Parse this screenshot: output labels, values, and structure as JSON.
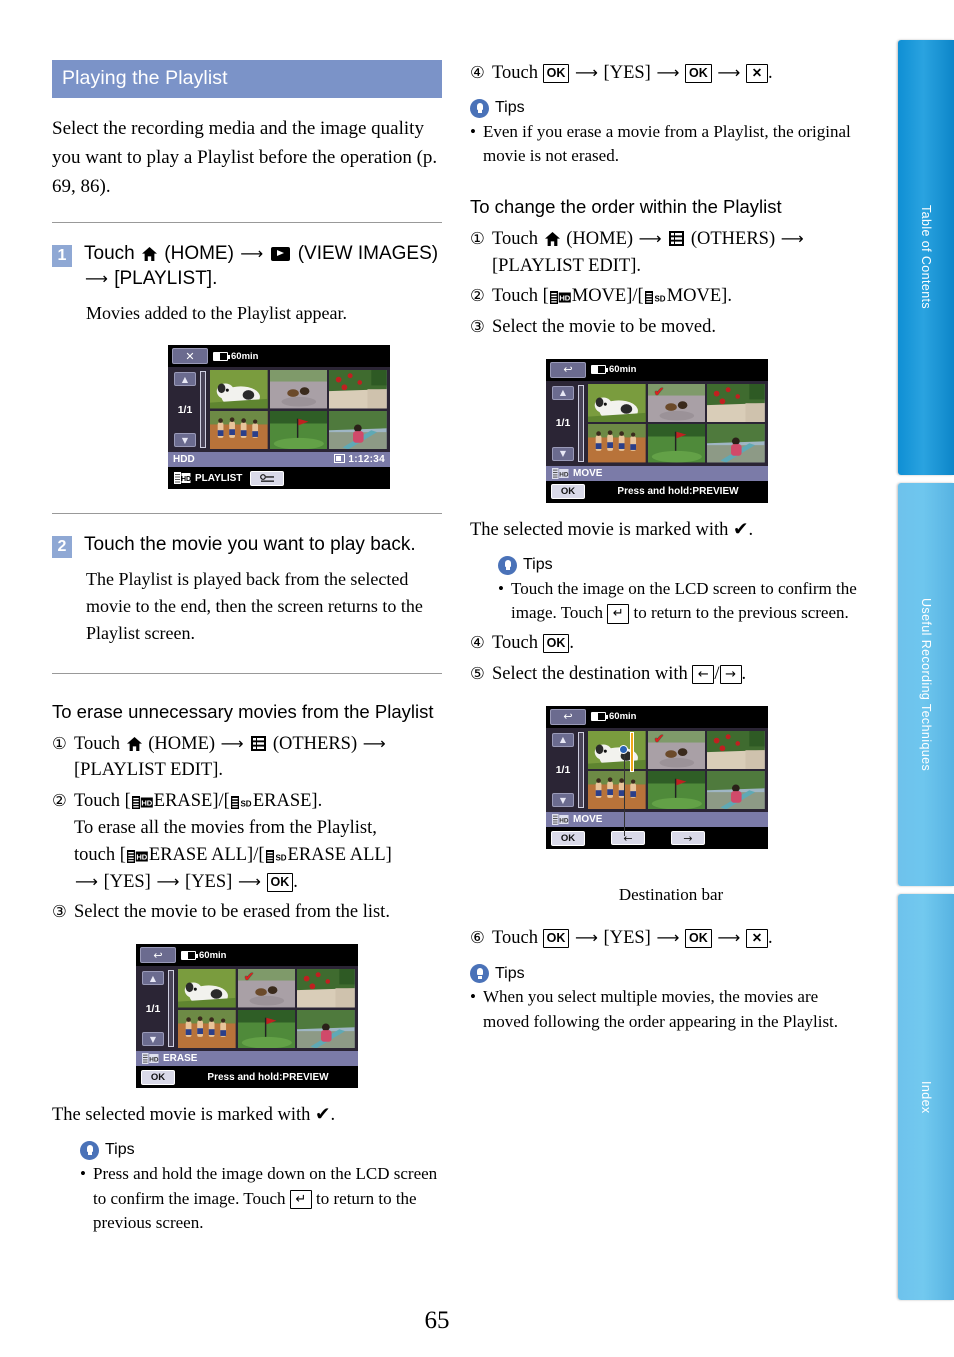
{
  "section": {
    "title": "Playing the Playlist",
    "intro": "Select the recording media and the image quality you want to play a Playlist before the operation (p. 69, 86)."
  },
  "steps": [
    {
      "num": "1",
      "title_pre": "Touch ",
      "title_home": "(HOME)",
      "title_view": "(VIEW IMAGES)",
      "title_end": "[PLAYLIST].",
      "desc": "Movies added to the Playlist appear."
    },
    {
      "num": "2",
      "title": "Touch the movie you want to play back.",
      "desc": "The Playlist is played back from the selected movie to the end, then the screen returns to the Playlist screen."
    }
  ],
  "erase_section": {
    "heading": "To erase unnecessary movies from the Playlist",
    "items": [
      {
        "num": "①",
        "text_a": "Touch ",
        "home": "(HOME)",
        "others": "(OTHERS)",
        "text_b": "[PLAYLIST EDIT]."
      },
      {
        "num": "②",
        "text_a": "Touch [",
        "hd": "HD",
        "text_b": "ERASE]/[",
        "sd": "SD",
        "text_c": "ERASE]."
      },
      {
        "num": "③",
        "text": "Select the movie to be erased from the list."
      }
    ],
    "erase_all_line1": "To erase all the movies from the Playlist,",
    "erase_all_pre": "touch [",
    "erase_all_mid": "ERASE ALL]/[",
    "erase_all_mid2": "ERASE ALL]",
    "yes": "[YES]",
    "ok": "OK",
    "marked_caption_pre": "The selected movie is marked with ",
    "marked_caption_check": "✔",
    "marked_caption_post": "."
  },
  "tips": {
    "label": "Tips",
    "left_erase": {
      "line": "Press and hold the image down on the LCD screen to confirm the image. Touch",
      "line_end": "to return to the previous screen.",
      "return_key": "↵"
    },
    "right_erase": "Even if you erase a movie from a Playlist, the original movie is not erased.",
    "right_move": {
      "line": "Touch the image on the LCD screen to confirm the image. Touch",
      "line_end": "to return to the previous screen."
    },
    "right_order": "When you select multiple movies, the movies are moved following the order appearing in the Playlist."
  },
  "right_col": {
    "step4_num": "④",
    "step4_touch": "Touch",
    "yes": "[YES]",
    "ok": "OK",
    "close": "✕",
    "order_heading": "To change the order within the Playlist",
    "order_items": [
      {
        "num": "①",
        "text_a": "Touch ",
        "home": "(HOME)",
        "others": "(OTHERS)",
        "text_b": "[PLAYLIST EDIT]."
      },
      {
        "num": "②",
        "text_a": "Touch [",
        "hd": "HD",
        "text_b": "MOVE]/[",
        "sd": "SD",
        "text_c": "MOVE]."
      },
      {
        "num": "③",
        "text": "Select the movie to be moved."
      }
    ],
    "marked_caption_pre": "The selected movie is marked with ",
    "marked_caption_check": "✔",
    "step4b_num": "④",
    "step4b_text": "Touch",
    "step5_num": "⑤",
    "step5_text": "Select the destination with",
    "arrow_left": "←",
    "arrow_right": "→",
    "destination_bar_label": "Destination bar",
    "step6_num": "⑥",
    "step6_touch": "Touch"
  },
  "lcd_playlist": {
    "close_icon": "✕",
    "battery": "60min",
    "page": "1/1",
    "up": "▲",
    "down": "▼",
    "media": "HDD",
    "duration": "1:12:34",
    "label": "PLAYLIST"
  },
  "lcd_erase": {
    "back_icon": "↩",
    "battery": "60min",
    "page": "1/1",
    "up": "▲",
    "down": "▼",
    "mode_label": "ERASE",
    "ok": "OK",
    "hint": "Press and hold:PREVIEW"
  },
  "lcd_move_select": {
    "back_icon": "↩",
    "battery": "60min",
    "page": "1/1",
    "up": "▲",
    "down": "▼",
    "mode_label": "MOVE",
    "ok": "OK",
    "hint": "Press and hold:PREVIEW"
  },
  "lcd_move_dest": {
    "back_icon": "↩",
    "battery": "60min",
    "page": "1/1",
    "up": "▲",
    "down": "▼",
    "mode_label": "MOVE",
    "ok": "OK",
    "arrow_left": "←",
    "arrow_right": "→"
  },
  "sidebar": {
    "tabs": [
      {
        "label": "Table of Contents",
        "color": "#1592d8"
      },
      {
        "label": "Useful Recording Techniques",
        "color": "#6ec6ee"
      },
      {
        "label": "Index",
        "color": "#6ec6ee"
      }
    ]
  },
  "page_number": "65"
}
